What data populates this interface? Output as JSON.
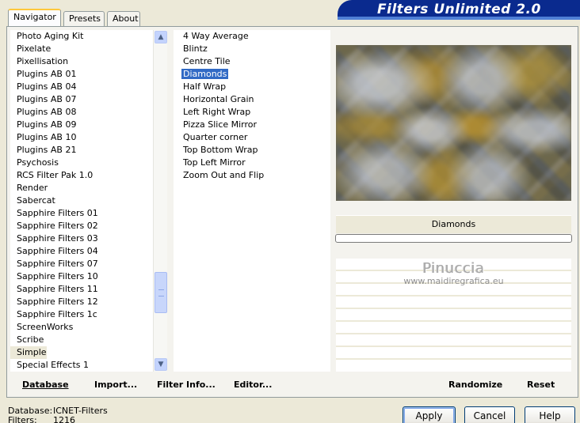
{
  "tabs": {
    "navigator": "Navigator",
    "presets": "Presets",
    "about": "About"
  },
  "title": "Filters Unlimited 2.0",
  "categories": [
    "Photo Aging Kit",
    "Pixelate",
    "Pixellisation",
    "Plugins AB 01",
    "Plugins AB 04",
    "Plugins AB 07",
    "Plugins AB 08",
    "Plugins AB 09",
    "Plugins AB 10",
    "Plugins AB 21",
    "Psychosis",
    "RCS Filter Pak 1.0",
    "Render",
    "Sabercat",
    "Sapphire Filters 01",
    "Sapphire Filters 02",
    "Sapphire Filters 03",
    "Sapphire Filters 04",
    "Sapphire Filters 07",
    "Sapphire Filters 10",
    "Sapphire Filters 11",
    "Sapphire Filters 12",
    "Sapphire Filters 1c",
    "ScreenWorks",
    "Scribe",
    "Simple",
    "Special Effects 1"
  ],
  "selected_category": "Simple",
  "filters": [
    "4 Way Average",
    "Blintz",
    "Centre Tile",
    "Diamonds",
    "Half Wrap",
    "Horizontal Grain",
    "Left Right Wrap",
    "Pizza Slice Mirror",
    "Quarter corner",
    "Top Bottom Wrap",
    "Top Left Mirror",
    "Zoom Out and Flip"
  ],
  "selected_filter": "Diamonds",
  "current_filter_label": "Diamonds",
  "watermark": {
    "name": "Pinuccia",
    "url": "www.maidiregrafica.eu"
  },
  "bottom_buttons": {
    "database": "Database",
    "import": "Import...",
    "filter_info": "Filter Info...",
    "editor": "Editor...",
    "randomize": "Randomize",
    "reset": "Reset"
  },
  "status": {
    "database_label": "Database:",
    "database_value": "ICNET-Filters",
    "filters_label": "Filters:",
    "filters_value": "1216"
  },
  "dialog_buttons": {
    "apply": "Apply",
    "cancel": "Cancel",
    "help": "Help"
  },
  "icons": {
    "scroll_up": "chevron-up-icon",
    "scroll_down": "chevron-down-icon"
  }
}
